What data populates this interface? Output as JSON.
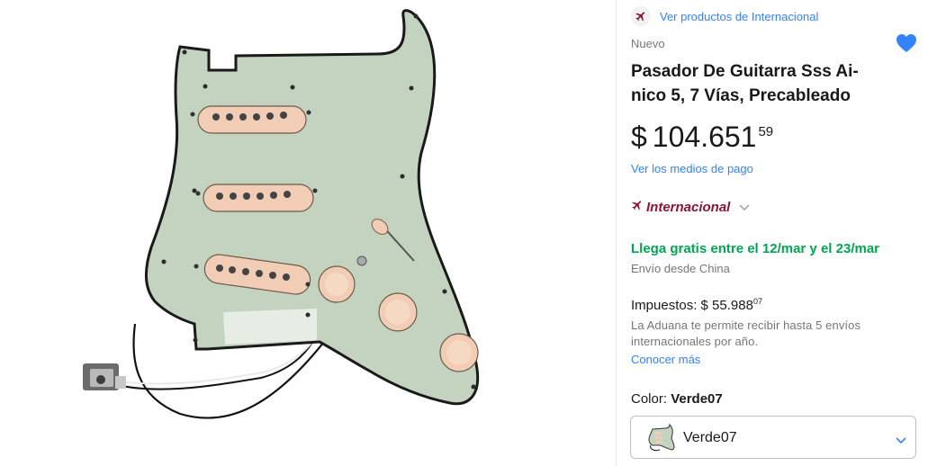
{
  "seller": {
    "store_link": "Ver productos de Internacional",
    "icon": "airplane-icon"
  },
  "product": {
    "condition": "Nuevo",
    "title": "Pasador De Guitarra Sss Ai-nico 5, 7 Vías, Precableado",
    "title_line1": "Pasador De Guitarra Sss Ai-",
    "title_line2": "nico 5, 7 Vías, Precableado",
    "favorite_icon": "heart-icon"
  },
  "price": {
    "currency": "$",
    "amount": "104.651",
    "cents": "59",
    "payment_link": "Ver los medios de pago"
  },
  "international": {
    "label": "Internacional",
    "color": "#8c1434"
  },
  "shipping": {
    "prefix": "Llega gratis entre el ",
    "day1": "12",
    "month1": "/mar",
    "middle": " y el ",
    "day2": "23",
    "month2": "/mar",
    "origin": "Envío desde China",
    "color": "#00a650"
  },
  "taxes": {
    "label": "Impuestos: ",
    "currency": "$",
    "amount": " 55.988",
    "cents": "07",
    "customs_note": "La Aduana te permite recibir hasta 5 envíos internacionales por año.",
    "more_link": "Conocer más"
  },
  "variant": {
    "color_label": "Color: ",
    "color_value": "Verde07",
    "selected": "Verde07"
  },
  "colors": {
    "link": "#3483fa",
    "accent": "#3483fa"
  }
}
